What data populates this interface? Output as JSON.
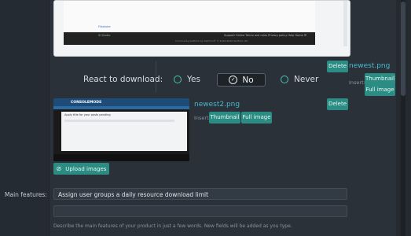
{
  "preview_card": {
    "doc_link": "Filestube",
    "footer_left": "⚙ Studio",
    "footer_links": "Support Online   Terms and rules   Privacy policy   Help   Home  ☰",
    "footer_copy": "Community platform by XenForo® © 2010-2022 XenForo Ltd."
  },
  "react_section": {
    "label": "React to download:",
    "options": [
      {
        "label": "Yes",
        "selected": false
      },
      {
        "label": "No",
        "selected": true
      },
      {
        "label": "Never",
        "selected": false
      }
    ]
  },
  "attachment1": {
    "delete_label": "Delete",
    "filename": "newest.png",
    "insert_label": "Insert:",
    "thumbnail_label": "Thumbnail",
    "full_image_label": "Full image"
  },
  "attachment2": {
    "delete_label": "Delete",
    "filename": "newest2.png",
    "insert_label": "Insert:",
    "thumbnail_label": "Thumbnail",
    "full_image_label": "Full image",
    "thumb_logo": "CONSOLEMODS",
    "thumb_title": "Apply title for your posts pending"
  },
  "upload": {
    "label": "Upload images"
  },
  "main_features": {
    "label": "Main features:",
    "values": [
      "Assign user groups a daily resource download limit",
      ""
    ],
    "hint": "Describe the main features of your product in just a few words. New fields will be added as you type."
  },
  "colors": {
    "background": "#2a3139",
    "accent": "#2a8c83",
    "link": "#49b9d0",
    "radio": "#46c3b0"
  }
}
